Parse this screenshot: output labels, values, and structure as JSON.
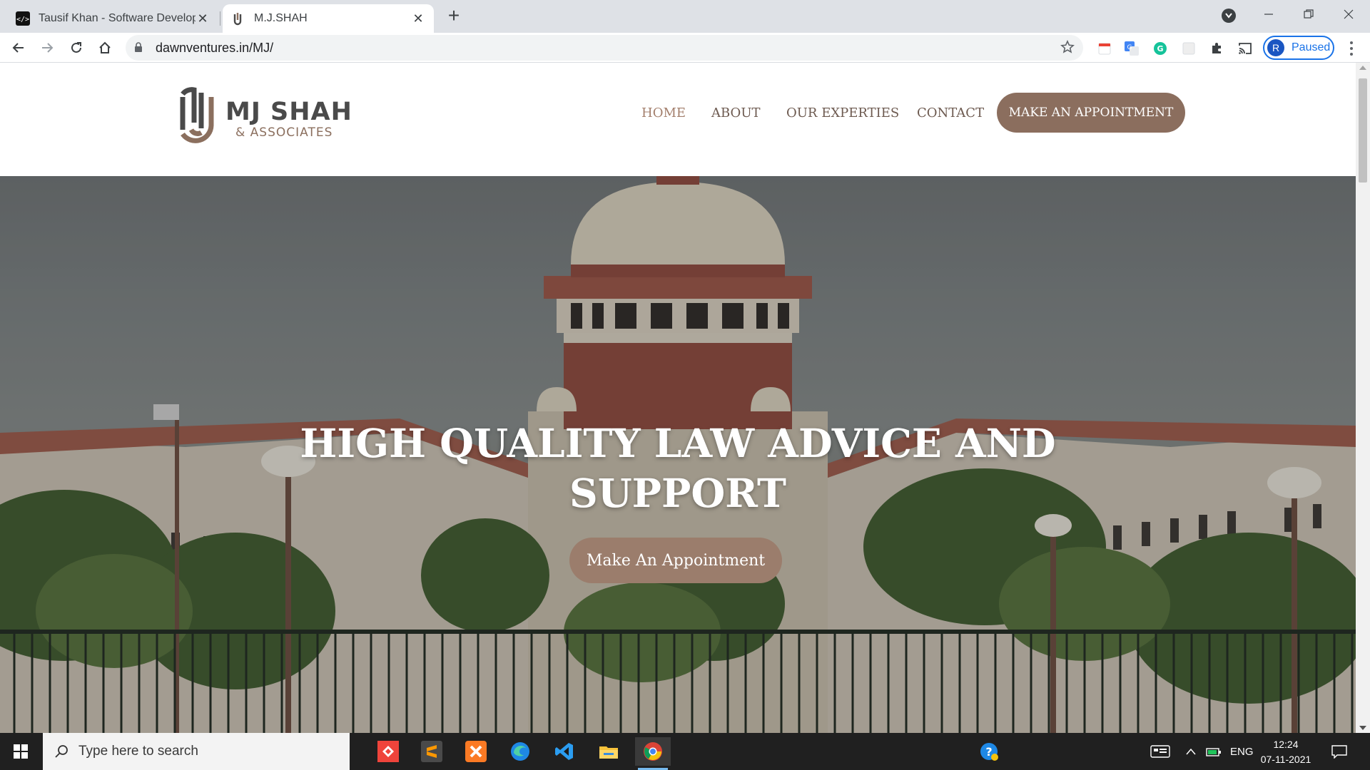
{
  "browser": {
    "tabs": [
      {
        "title": "Tausif Khan - Software Developer",
        "active": false
      },
      {
        "title": "M.J.SHAH",
        "active": true
      }
    ],
    "url": "dawnventures.in/MJ/",
    "profile_initial": "R",
    "profile_status": "Paused",
    "accent_color": "#1a73e8"
  },
  "site": {
    "logo": {
      "line1": "MJ SHAH",
      "line2": "& ASSOCIATES"
    },
    "nav": {
      "items": [
        "HOME",
        "ABOUT",
        "OUR EXPERTIES",
        "CONTACT"
      ],
      "cta": "MAKE AN APPOINTMENT"
    },
    "hero": {
      "title": "HIGH QUALITY LAW ADVICE AND SUPPORT",
      "cta": "Make An Appointment"
    },
    "colors": {
      "brand": "#8b6e5e",
      "nav_text": "#6d5a50",
      "nav_active": "#a37f6c"
    }
  },
  "taskbar": {
    "search_placeholder": "Type here to search",
    "apps": [
      "anydesk-icon",
      "sublime-text-icon",
      "xampp-icon",
      "edge-icon",
      "vscode-icon",
      "file-explorer-icon",
      "chrome-icon"
    ],
    "language": "ENG",
    "time": "12:24",
    "date": "07-11-2021"
  }
}
